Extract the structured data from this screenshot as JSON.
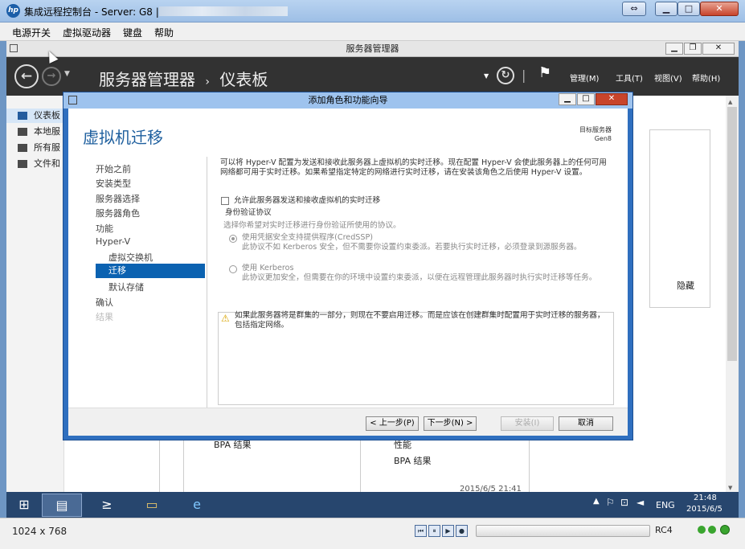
{
  "ilo": {
    "title": "集成远程控制台 - Server: G8 |",
    "menu": [
      "电源开关",
      "虚拟驱动器",
      "键盘",
      "帮助"
    ],
    "status_resolution": "1024 x 768",
    "rc_label": "RC4"
  },
  "server_manager": {
    "window_title": "服务器管理器",
    "breadcrumb_app": "服务器管理器",
    "breadcrumb_sep": "›",
    "breadcrumb_page": "仪表板",
    "menus": [
      "管理(M)",
      "工具(T)",
      "视图(V)",
      "帮助(H)"
    ],
    "sidebar": [
      "仪表板",
      "本地服",
      "所有服",
      "文件和"
    ],
    "bg_hide": "隐藏",
    "bg_bpa1": "BPA 结果",
    "bg_perf": "性能",
    "bg_bpa2": "BPA 结果",
    "bg_timestamp": "2015/6/5 21:41"
  },
  "taskbar": {
    "lang": "ENG",
    "time": "21:48",
    "date": "2015/6/5"
  },
  "wizard": {
    "title": "添加角色和功能向导",
    "heading": "虚拟机迁移",
    "target_label": "目标服务器",
    "target_value": "Gen8",
    "nav": [
      "开始之前",
      "安装类型",
      "服务器选择",
      "服务器角色",
      "功能",
      "Hyper-V",
      "虚拟交换机",
      "迁移",
      "默认存储",
      "确认",
      "结果"
    ],
    "intro": "可以将 Hyper-V 配置为发送和接收此服务器上虚拟机的实时迁移。现在配置 Hyper-V 会使此服务器上的任何可用网络都可用于实时迁移。如果希望指定特定的网络进行实时迁移，请在安装该角色之后使用 Hyper-V 设置。",
    "checkbox_label": "允许此服务器发送和接收虚拟机的实时迁移",
    "group_title": "身份验证协议",
    "group_desc": "选择你希望对实时迁移进行身份验证所使用的协议。",
    "opt1_title": "使用凭据安全支持提供程序(CredSSP)",
    "opt1_desc": "此协议不如 Kerberos 安全，但不需要你设置约束委派。若要执行实时迁移，必须登录到源服务器。",
    "opt2_title": "使用 Kerberos",
    "opt2_desc": "此协议更加安全，但需要在你的环境中设置约束委派，以便在远程管理此服务器时执行实时迁移等任务。",
    "warning": "如果此服务器将是群集的一部分，则现在不要启用迁移。而是应该在创建群集时配置用于实时迁移的服务器，包括指定网络。",
    "btn_prev": "< 上一步(P)",
    "btn_next": "下一步(N) >",
    "btn_install": "安装(I)",
    "btn_cancel": "取消"
  }
}
